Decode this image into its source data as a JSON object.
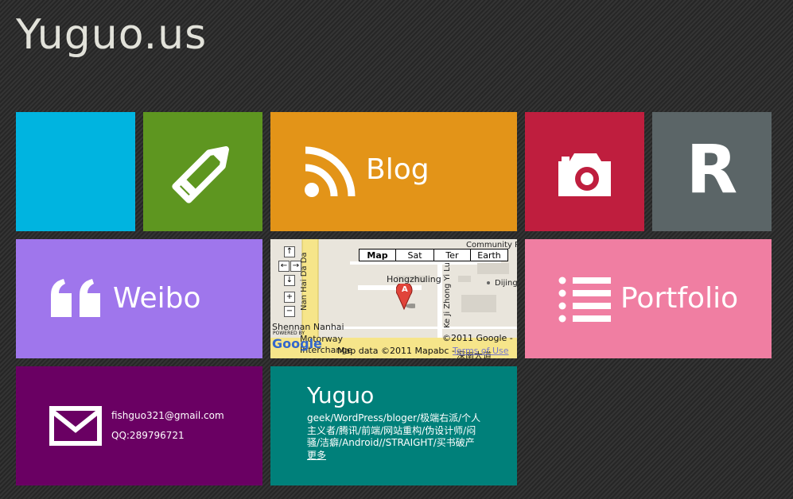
{
  "site": {
    "title": "Yuguo.us"
  },
  "tiles": {
    "blog": {
      "label": "Blog"
    },
    "weibo": {
      "label": "Weibo"
    },
    "portfolio": {
      "label": "Portfolio"
    },
    "r_tile": {
      "letter": "R"
    },
    "contact": {
      "email": "fishguo321@gmail.com",
      "qq": "QQ:289796721"
    },
    "about": {
      "title": "Yuguo",
      "description": "geek/WordPress/bloger/极端右派/个人主义者/腾讯/前端/网站重构/伪设计师/闷骚/洁癖/Android//STRAIGHT/买书破产",
      "more_link": "更多"
    }
  },
  "map": {
    "types": [
      "Map",
      "Sat",
      "Ter",
      "Earth"
    ],
    "selected_type": "Map",
    "labels": {
      "place": "Hongzhuling",
      "road_vertical": "Nan Hai Da Da",
      "road_keji": "Ke Ji Zhong Yi Lu",
      "motorway": "Shennan Nanhai",
      "motorway2": "Motorway",
      "interchange": "Interchange",
      "community": "Community P",
      "dijing": "Dijing",
      "marker": "A",
      "powered_by": "POWERED BY",
      "google_logo": "Google",
      "copyright": "©2011 Google -",
      "map_data": "Map data ©2011 Mapabc -",
      "terms": "Terms of Use",
      "road_cn": "深南大道"
    },
    "controls": {
      "up": "↑",
      "left": "←",
      "right": "→",
      "down": "↓",
      "zoom_in": "+",
      "zoom_out": "−"
    }
  },
  "colors": {
    "cyan": "#00b4e0",
    "green": "#5e9620",
    "orange": "#e39418",
    "red": "#bf1e3e",
    "slate": "#5b6567",
    "purple": "#9f76ec",
    "pink": "#f07ea2",
    "plum": "#6a0063",
    "teal": "#00807a"
  }
}
